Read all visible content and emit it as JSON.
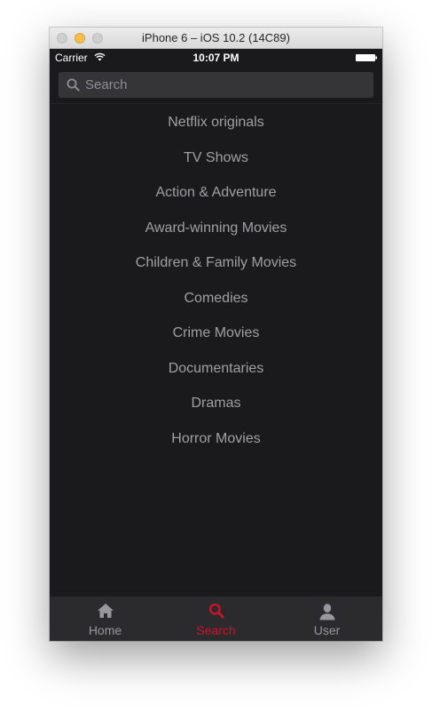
{
  "window": {
    "title": "iPhone 6 – iOS 10.2 (14C89)"
  },
  "status_bar": {
    "carrier": "Carrier",
    "time": "10:07 PM"
  },
  "search": {
    "placeholder": "Search",
    "value": ""
  },
  "categories": [
    {
      "label": "Netflix originals"
    },
    {
      "label": "TV Shows"
    },
    {
      "label": "Action & Adventure"
    },
    {
      "label": "Award-winning Movies"
    },
    {
      "label": "Children & Family Movies"
    },
    {
      "label": "Comedies"
    },
    {
      "label": "Crime Movies"
    },
    {
      "label": "Documentaries"
    },
    {
      "label": "Dramas"
    },
    {
      "label": "Horror Movies"
    }
  ],
  "tabs": [
    {
      "label": "Home",
      "icon": "home-icon",
      "active": false
    },
    {
      "label": "Search",
      "icon": "search-icon",
      "active": true
    },
    {
      "label": "User",
      "icon": "user-icon",
      "active": false
    }
  ],
  "colors": {
    "background": "#1a1a1c",
    "accent": "#d0112b",
    "inactive_tab": "#98989c",
    "list_text": "#a0a0a3",
    "tab_bar": "#2b2b2e"
  }
}
